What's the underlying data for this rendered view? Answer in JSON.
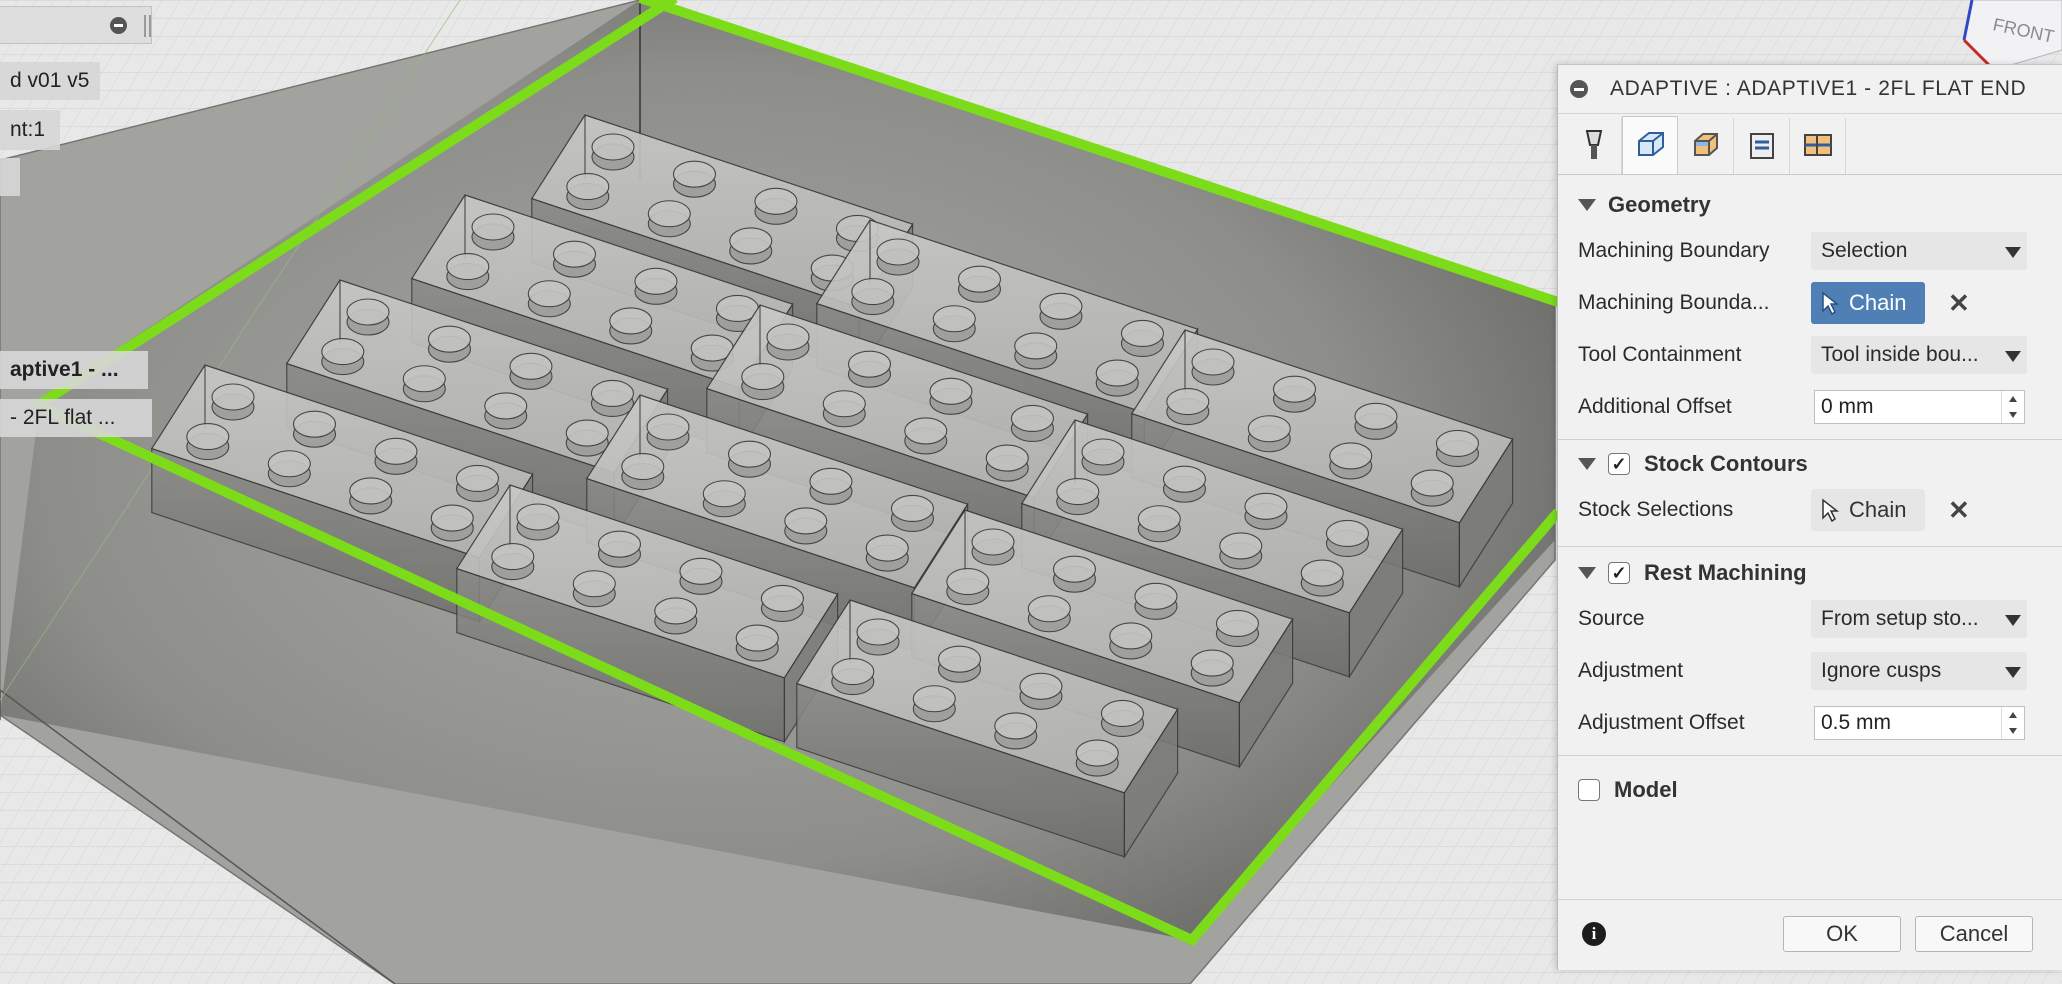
{
  "overlay": {
    "doc_version": "d v01 v5",
    "count_label": "nt:1",
    "op_label": "aptive1 - ...",
    "tool_label": "- 2FL flat ..."
  },
  "viewcube": {
    "face": "FRONT"
  },
  "colors": {
    "boundary": "#7ddc1a",
    "accent": "#4f7fb5",
    "panel_bg": "#f1f1f1"
  },
  "panel": {
    "title": "ADAPTIVE : ADAPTIVE1 - 2FL FLAT END",
    "tabs": [
      {
        "name": "tool-tab-icon",
        "active": false
      },
      {
        "name": "geometry-tab-icon",
        "active": true
      },
      {
        "name": "heights-tab-icon",
        "active": false
      },
      {
        "name": "passes-tab-icon",
        "active": false
      },
      {
        "name": "linking-tab-icon",
        "active": false
      }
    ],
    "geometry": {
      "heading": "Geometry",
      "machining_boundary_label": "Machining Boundary",
      "machining_boundary_value": "Selection",
      "boundary_selection_label": "Machining Bounda...",
      "boundary_selection_button": "Chain",
      "tool_containment_label": "Tool Containment",
      "tool_containment_value": "Tool inside bou...",
      "additional_offset_label": "Additional Offset",
      "additional_offset_value": "0 mm"
    },
    "stock_contours": {
      "heading": "Stock Contours",
      "checked": true,
      "check_glyph": "✓",
      "selections_label": "Stock Selections",
      "selections_button": "Chain"
    },
    "rest_machining": {
      "heading": "Rest Machining",
      "checked": true,
      "check_glyph": "✓",
      "source_label": "Source",
      "source_value": "From setup sto...",
      "adjustment_label": "Adjustment",
      "adjustment_value": "Ignore cusps",
      "adjustment_offset_label": "Adjustment Offset",
      "adjustment_offset_value": "0.5 mm"
    },
    "model": {
      "heading": "Model",
      "checked": false
    },
    "footer": {
      "info_glyph": "i",
      "ok_label": "OK",
      "cancel_label": "Cancel"
    }
  }
}
